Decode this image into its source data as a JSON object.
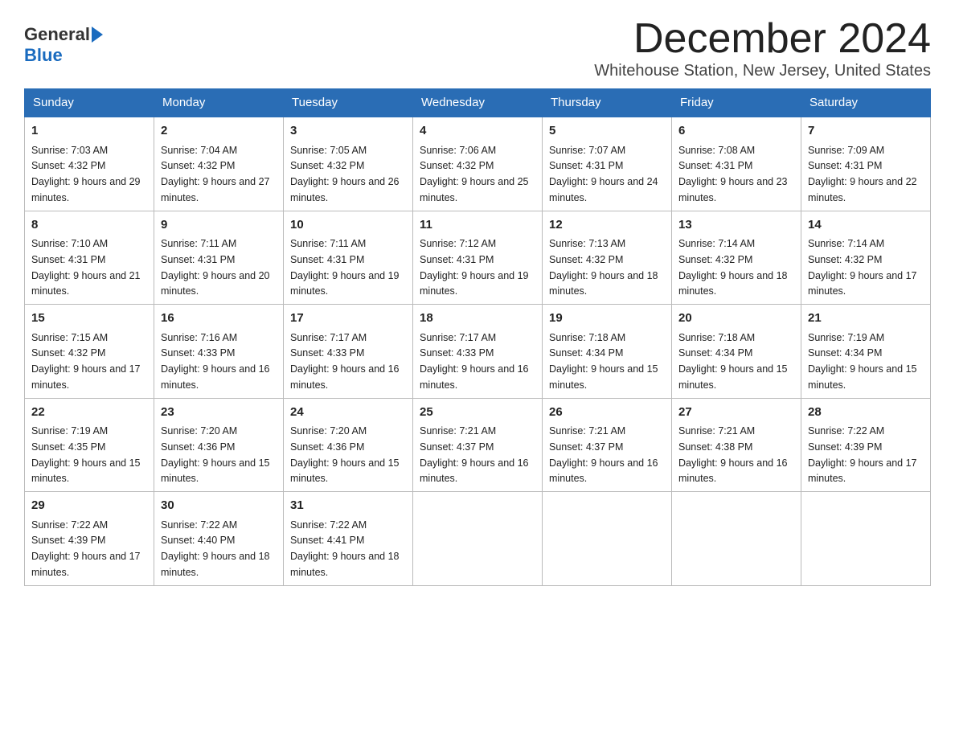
{
  "header": {
    "logo_general": "General",
    "logo_blue": "Blue",
    "month_title": "December 2024",
    "location": "Whitehouse Station, New Jersey, United States"
  },
  "days_of_week": [
    "Sunday",
    "Monday",
    "Tuesday",
    "Wednesday",
    "Thursday",
    "Friday",
    "Saturday"
  ],
  "weeks": [
    [
      {
        "day": "1",
        "sunrise": "7:03 AM",
        "sunset": "4:32 PM",
        "daylight": "9 hours and 29 minutes."
      },
      {
        "day": "2",
        "sunrise": "7:04 AM",
        "sunset": "4:32 PM",
        "daylight": "9 hours and 27 minutes."
      },
      {
        "day": "3",
        "sunrise": "7:05 AM",
        "sunset": "4:32 PM",
        "daylight": "9 hours and 26 minutes."
      },
      {
        "day": "4",
        "sunrise": "7:06 AM",
        "sunset": "4:32 PM",
        "daylight": "9 hours and 25 minutes."
      },
      {
        "day": "5",
        "sunrise": "7:07 AM",
        "sunset": "4:31 PM",
        "daylight": "9 hours and 24 minutes."
      },
      {
        "day": "6",
        "sunrise": "7:08 AM",
        "sunset": "4:31 PM",
        "daylight": "9 hours and 23 minutes."
      },
      {
        "day": "7",
        "sunrise": "7:09 AM",
        "sunset": "4:31 PM",
        "daylight": "9 hours and 22 minutes."
      }
    ],
    [
      {
        "day": "8",
        "sunrise": "7:10 AM",
        "sunset": "4:31 PM",
        "daylight": "9 hours and 21 minutes."
      },
      {
        "day": "9",
        "sunrise": "7:11 AM",
        "sunset": "4:31 PM",
        "daylight": "9 hours and 20 minutes."
      },
      {
        "day": "10",
        "sunrise": "7:11 AM",
        "sunset": "4:31 PM",
        "daylight": "9 hours and 19 minutes."
      },
      {
        "day": "11",
        "sunrise": "7:12 AM",
        "sunset": "4:31 PM",
        "daylight": "9 hours and 19 minutes."
      },
      {
        "day": "12",
        "sunrise": "7:13 AM",
        "sunset": "4:32 PM",
        "daylight": "9 hours and 18 minutes."
      },
      {
        "day": "13",
        "sunrise": "7:14 AM",
        "sunset": "4:32 PM",
        "daylight": "9 hours and 18 minutes."
      },
      {
        "day": "14",
        "sunrise": "7:14 AM",
        "sunset": "4:32 PM",
        "daylight": "9 hours and 17 minutes."
      }
    ],
    [
      {
        "day": "15",
        "sunrise": "7:15 AM",
        "sunset": "4:32 PM",
        "daylight": "9 hours and 17 minutes."
      },
      {
        "day": "16",
        "sunrise": "7:16 AM",
        "sunset": "4:33 PM",
        "daylight": "9 hours and 16 minutes."
      },
      {
        "day": "17",
        "sunrise": "7:17 AM",
        "sunset": "4:33 PM",
        "daylight": "9 hours and 16 minutes."
      },
      {
        "day": "18",
        "sunrise": "7:17 AM",
        "sunset": "4:33 PM",
        "daylight": "9 hours and 16 minutes."
      },
      {
        "day": "19",
        "sunrise": "7:18 AM",
        "sunset": "4:34 PM",
        "daylight": "9 hours and 15 minutes."
      },
      {
        "day": "20",
        "sunrise": "7:18 AM",
        "sunset": "4:34 PM",
        "daylight": "9 hours and 15 minutes."
      },
      {
        "day": "21",
        "sunrise": "7:19 AM",
        "sunset": "4:34 PM",
        "daylight": "9 hours and 15 minutes."
      }
    ],
    [
      {
        "day": "22",
        "sunrise": "7:19 AM",
        "sunset": "4:35 PM",
        "daylight": "9 hours and 15 minutes."
      },
      {
        "day": "23",
        "sunrise": "7:20 AM",
        "sunset": "4:36 PM",
        "daylight": "9 hours and 15 minutes."
      },
      {
        "day": "24",
        "sunrise": "7:20 AM",
        "sunset": "4:36 PM",
        "daylight": "9 hours and 15 minutes."
      },
      {
        "day": "25",
        "sunrise": "7:21 AM",
        "sunset": "4:37 PM",
        "daylight": "9 hours and 16 minutes."
      },
      {
        "day": "26",
        "sunrise": "7:21 AM",
        "sunset": "4:37 PM",
        "daylight": "9 hours and 16 minutes."
      },
      {
        "day": "27",
        "sunrise": "7:21 AM",
        "sunset": "4:38 PM",
        "daylight": "9 hours and 16 minutes."
      },
      {
        "day": "28",
        "sunrise": "7:22 AM",
        "sunset": "4:39 PM",
        "daylight": "9 hours and 17 minutes."
      }
    ],
    [
      {
        "day": "29",
        "sunrise": "7:22 AM",
        "sunset": "4:39 PM",
        "daylight": "9 hours and 17 minutes."
      },
      {
        "day": "30",
        "sunrise": "7:22 AM",
        "sunset": "4:40 PM",
        "daylight": "9 hours and 18 minutes."
      },
      {
        "day": "31",
        "sunrise": "7:22 AM",
        "sunset": "4:41 PM",
        "daylight": "9 hours and 18 minutes."
      },
      null,
      null,
      null,
      null
    ]
  ],
  "labels": {
    "sunrise": "Sunrise:",
    "sunset": "Sunset:",
    "daylight": "Daylight:"
  }
}
